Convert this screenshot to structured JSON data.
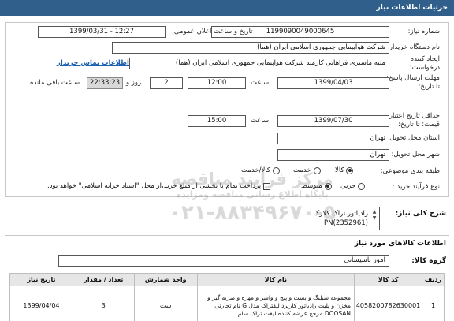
{
  "header": {
    "title": "جزئیات اطلاعات نیاز"
  },
  "form": {
    "need_number_label": "شماره نیاز:",
    "need_number_value": "1199090049000645",
    "announce_label": "تاریخ و ساعت اعلان عمومی:",
    "announce_value": "1399/03/31 - 12:27",
    "buyer_label": "نام دستگاه خریدار:",
    "buyer_value": "شرکت هواپیمایی جمهوری اسلامی ایران (هما)",
    "creator_label": "ایجاد کننده درخواست:",
    "creator_value": "مثیه ماستری فراهانی کارمند شرکت هواپیمایی جمهوری اسلامی ایران (هما)",
    "contact_link": "اطلاعات تماس خریدار",
    "deadline_label": "مهلت ارسال پاسخ: تا تاریخ:",
    "deadline_date": "1399/04/03",
    "time_label": "ساعت",
    "deadline_time": "12:00",
    "days_value": "2",
    "days_label": "روز و",
    "remaining_time": "22:33:23",
    "remaining_label": "ساعت باقی مانده",
    "validity_label": "حداقل تاریخ اعتبار قیمت: تا تاریخ:",
    "validity_date": "1399/07/30",
    "validity_time_label": "ساعت",
    "validity_time": "15:00",
    "province_label": "استان محل تحویل:",
    "province_value": "تهران",
    "city_label": "شهر محل تحویل:",
    "city_value": "تهران",
    "category_label": "طبقه بندی موضوعی:",
    "category_options": [
      "کالا",
      "خدمت",
      "کالا/خدمت"
    ],
    "category_selected": "کالا",
    "process_label": "نوع فرآیند خرید :",
    "process_options": [
      "جزیی",
      "متوسط"
    ],
    "process_selected": "متوسط",
    "payment_note": "پرداخت تمام یا بخشی از مبلغ خرید،از محل \"اسناد خزانه اسلامی\" خواهد بود."
  },
  "summary": {
    "label": "شرح کلی نیاز:",
    "line1": "رادیاتور تراک کلارک",
    "line2": "PN(2352961)"
  },
  "goods": {
    "section_title": "اطلاعات کالاهای مورد نیاز",
    "group_label": "گروه کالا:",
    "group_value": "امور تاسیساتی",
    "columns": [
      "ردیف",
      "کد کالا",
      "نام کالا",
      "واحد شمارش",
      "تعداد / مقدار",
      "تاریخ نیاز"
    ],
    "rows": [
      {
        "index": "1",
        "code": "4058200782630001",
        "name": "مجموعه شیلنگ و بست و پیچ و واشر و مهره و ضربه گیر و مخزن و پلیت رادیاتور کاربرد لیفتراک مدل G نام تجارتی DOOSAN مرجع عرضه کننده لیفت تراک سام",
        "unit": "ست",
        "qty": "3",
        "date": "1399/04/04"
      }
    ]
  },
  "watermark": {
    "line1": "مرکز فرآیند مناقصه",
    "line2": "پایگاه اطلاع رسانی مناقصه ومزایده",
    "line3": "۰۲۱-۸۸۳۴۹۶۷۰-۵"
  }
}
